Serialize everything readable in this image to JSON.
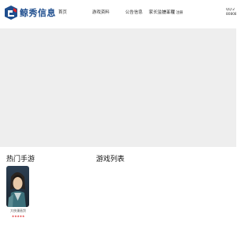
{
  "header": {
    "logo_text": "鲸秀信息",
    "brand_color": "#1f4e8e",
    "accent_color": "#d9242b",
    "nav": [
      {
        "label": "首页"
      },
      {
        "label": "游戏资料"
      },
      {
        "label": "公告信息"
      },
      {
        "label": "家长监护工程"
      }
    ],
    "login": {
      "label": "登录",
      "separator": "或",
      "register": "注册"
    },
    "contact": {
      "qq": "QQ:2",
      "phone": "80808"
    }
  },
  "sections": {
    "hot_games_title": "热门手游",
    "game_list_title": "游戏列表"
  },
  "hot_games": [
    {
      "name": "大侠漫画剑",
      "rating": 5,
      "stars_text": "★★★★★",
      "icon": "game-character-icon"
    }
  ]
}
